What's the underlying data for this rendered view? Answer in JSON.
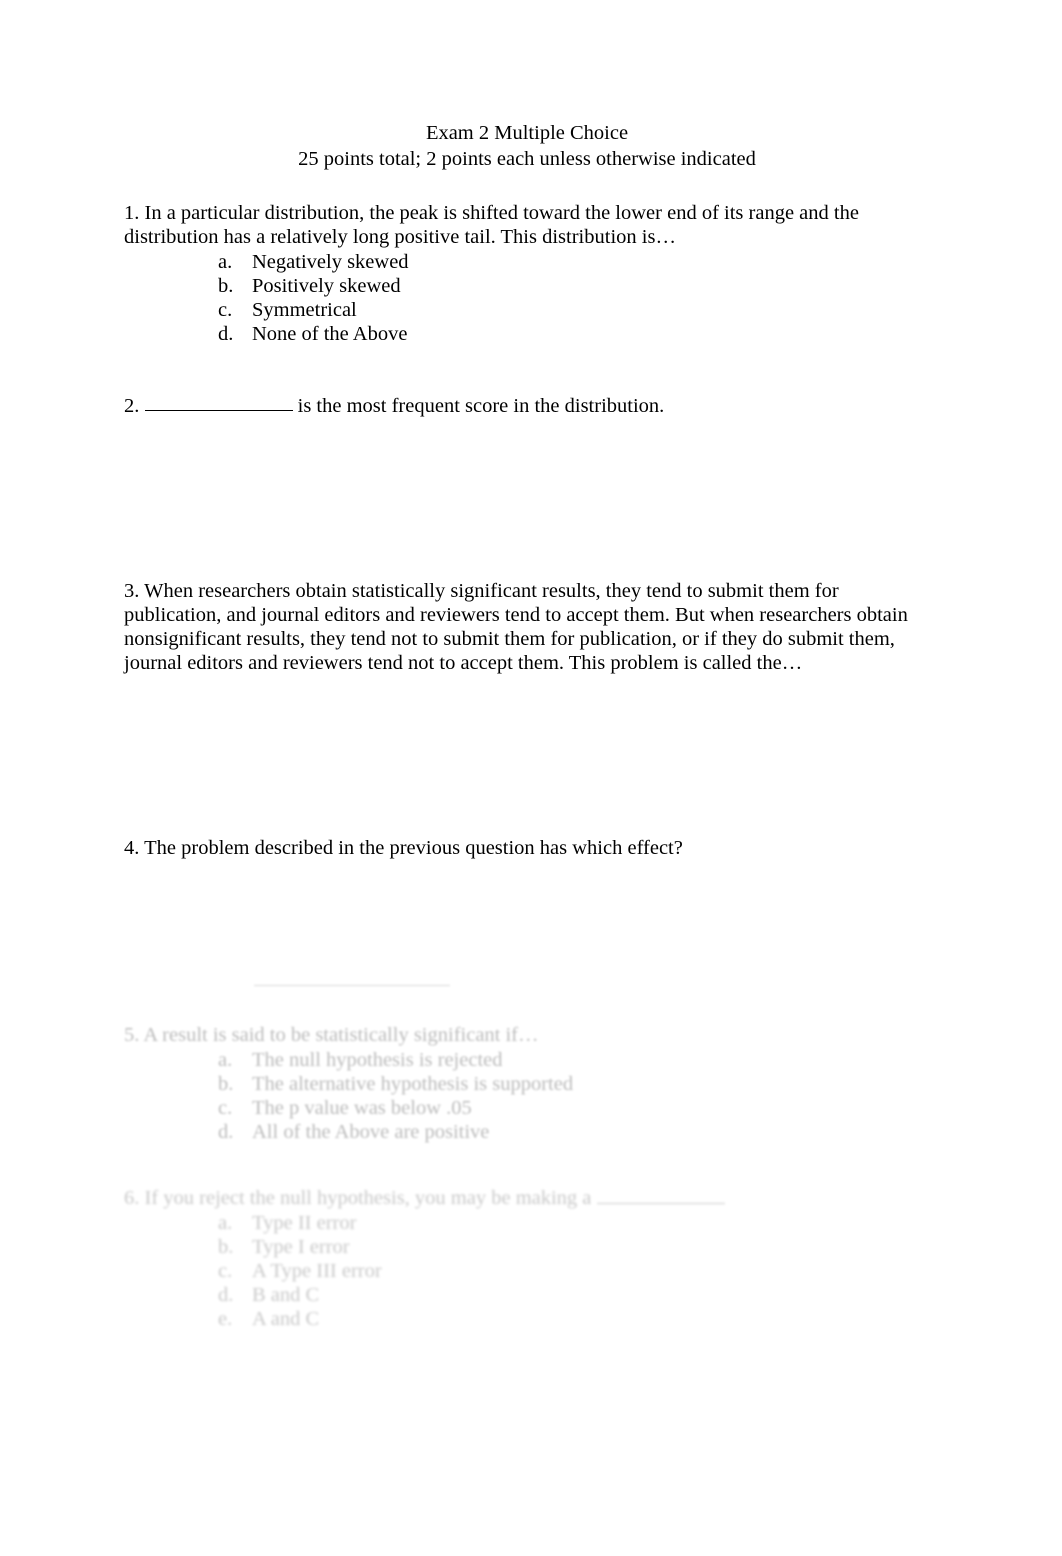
{
  "document": {
    "title_lines": [
      "Exam 2 Multiple Choice",
      "25 points total; 2 points each unless otherwise indicated"
    ]
  },
  "questions": [
    {
      "number": "1.",
      "text": "1. In a particular distribution, the peak is shifted toward the lower end of its range and the distribution has a relatively long positive tail. This distribution is…",
      "options": [
        {
          "marker": "a.",
          "label": "Negatively skewed"
        },
        {
          "marker": "b.",
          "label": "Positively skewed"
        },
        {
          "marker": "c.",
          "label": "Symmetrical"
        },
        {
          "marker": "d.",
          "label": "None of the Above"
        }
      ]
    },
    {
      "number": "2.",
      "prefix": "2. ",
      "suffix": " is the most frequent score in the distribution.",
      "options": []
    },
    {
      "number": "3.",
      "text": "3. When researchers obtain statistically significant results, they tend to submit them for publication, and journal editors and reviewers tend to accept them. But when researchers obtain nonsignificant results, they tend not to submit them for publication, or if they do submit them, journal editors and reviewers tend not to accept them. This problem is called the…",
      "options": []
    },
    {
      "number": "4.",
      "text": "4. The problem described in the previous question has which effect?",
      "options": []
    },
    {
      "number": "5.",
      "text": "5. A result is said to be statistically significant if…",
      "options": [
        {
          "marker": "a.",
          "label": "The null hypothesis is rejected"
        },
        {
          "marker": "b.",
          "label": "The alternative hypothesis is supported"
        },
        {
          "marker": "c.",
          "label": "The p value was below .05"
        },
        {
          "marker": "d.",
          "label": "All of the Above are positive"
        }
      ]
    },
    {
      "number": "6.",
      "prefix": "6. If you reject the null hypothesis, you may be making a ",
      "suffix": "",
      "options": [
        {
          "marker": "a.",
          "label": "Type II error"
        },
        {
          "marker": "b.",
          "label": "Type I error"
        },
        {
          "marker": "c.",
          "label": "A Type III error"
        },
        {
          "marker": "d.",
          "label": "B and C"
        },
        {
          "marker": "e.",
          "label": "A and C"
        }
      ]
    }
  ]
}
